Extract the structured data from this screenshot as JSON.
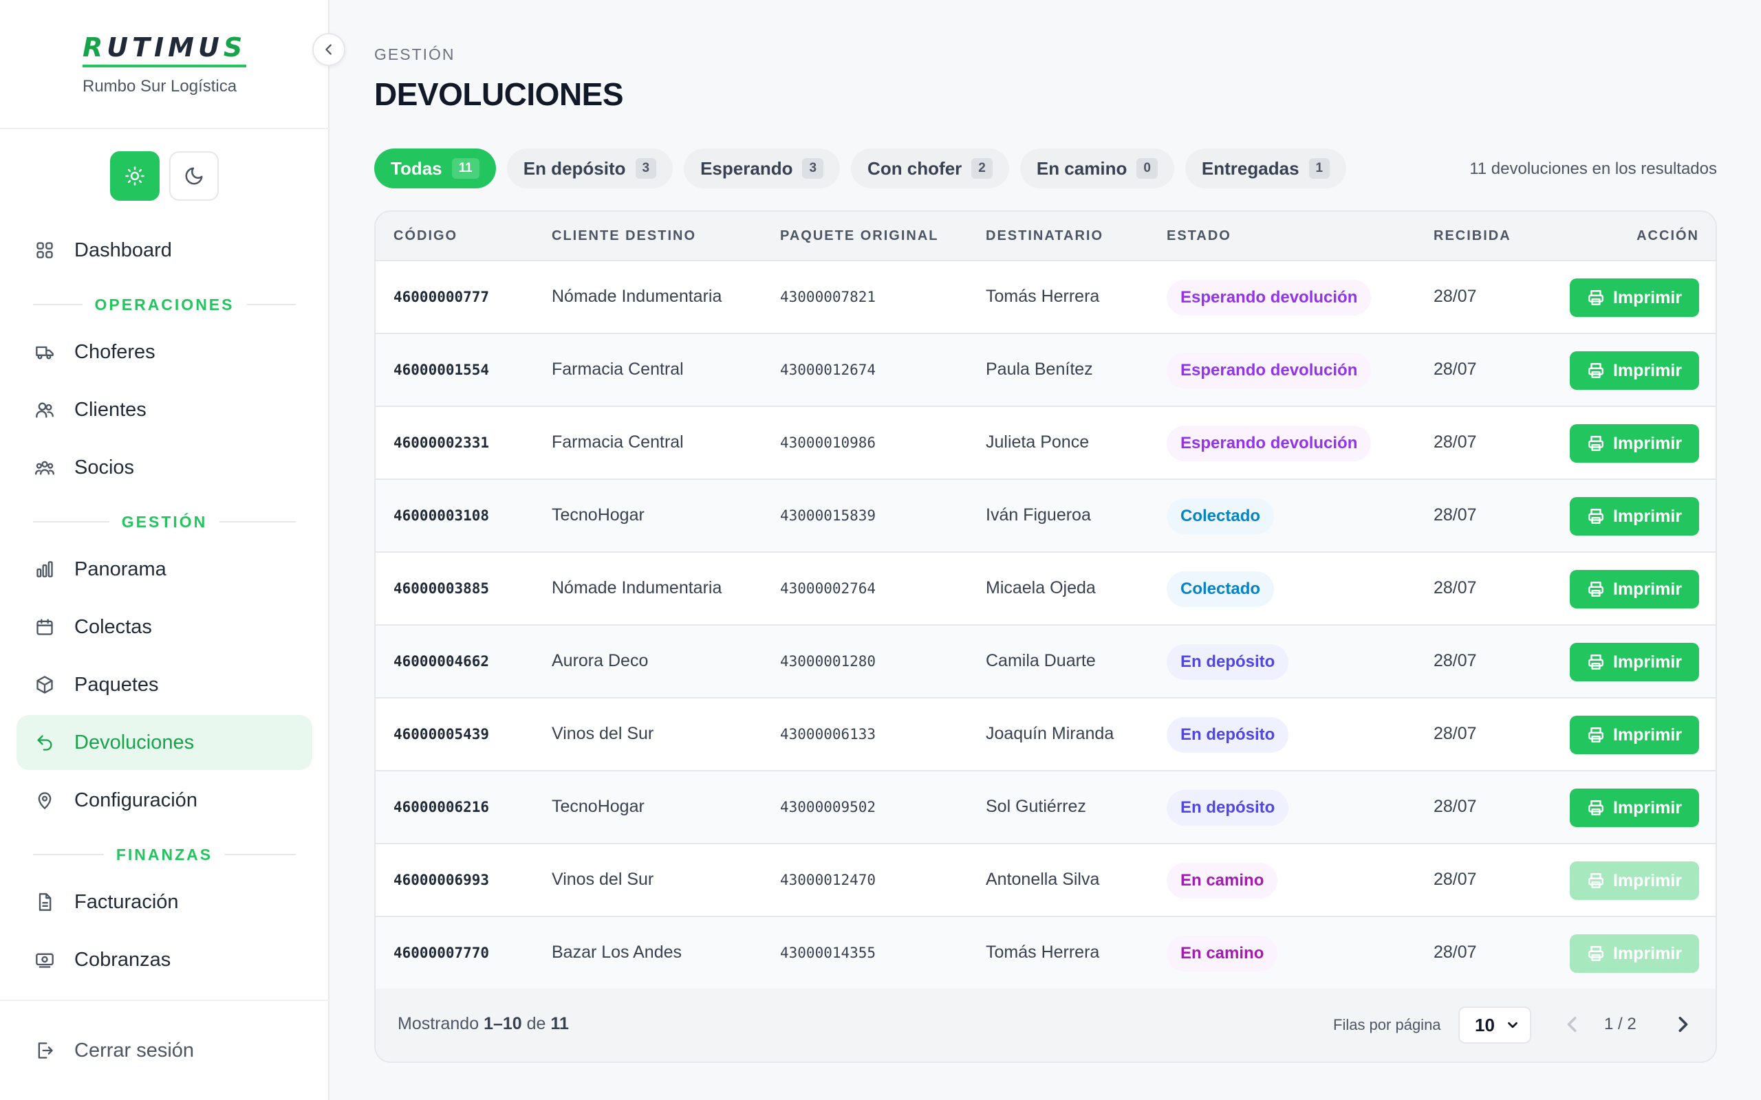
{
  "brand": {
    "logo_r": "R",
    "logo_mid": "UTIMU",
    "logo_s": "S",
    "subtitle": "Rumbo Sur Logística"
  },
  "theme": {
    "light_icon": "sun-icon",
    "dark_icon": "moon-icon",
    "active": "light"
  },
  "sidebar": {
    "dashboard": "Dashboard",
    "section_operaciones": "OPERACIONES",
    "choferes": "Choferes",
    "clientes": "Clientes",
    "socios": "Socios",
    "section_gestion": "GESTIÓN",
    "panorama": "Panorama",
    "colectas": "Colectas",
    "paquetes": "Paquetes",
    "devoluciones": "Devoluciones",
    "configuracion": "Configuración",
    "section_finanzas": "FINANZAS",
    "facturacion": "Facturación",
    "cobranzas": "Cobranzas",
    "logout": "Cerrar sesión"
  },
  "header": {
    "breadcrumb": "GESTIÓN",
    "title": "DEVOLUCIONES"
  },
  "filters": [
    {
      "label": "Todas",
      "count": "11",
      "active": true
    },
    {
      "label": "En depósito",
      "count": "3"
    },
    {
      "label": "Esperando",
      "count": "3"
    },
    {
      "label": "Con chofer",
      "count": "2"
    },
    {
      "label": "En camino",
      "count": "0"
    },
    {
      "label": "Entregadas",
      "count": "1"
    }
  ],
  "results_text": "11 devoluciones en los resultados",
  "table": {
    "headers": {
      "code": "CÓDIGO",
      "client": "CLIENTE DESTINO",
      "package": "PAQUETE ORIGINAL",
      "recipient": "DESTINATARIO",
      "status": "ESTADO",
      "received": "RECIBIDA",
      "action": "ACCIÓN"
    },
    "action_label": "Imprimir",
    "rows": [
      {
        "code": "46000000777",
        "client": "Nómade Indumentaria",
        "package": "43000007821",
        "recipient": "Tomás Herrera",
        "status": "Esperando devolución",
        "received": "28/07"
      },
      {
        "code": "46000001554",
        "client": "Farmacia Central",
        "package": "43000012674",
        "recipient": "Paula Benítez",
        "status": "Esperando devolución",
        "received": "28/07"
      },
      {
        "code": "46000002331",
        "client": "Farmacia Central",
        "package": "43000010986",
        "recipient": "Julieta Ponce",
        "status": "Esperando devolución",
        "received": "28/07"
      },
      {
        "code": "46000003108",
        "client": "TecnoHogar",
        "package": "43000015839",
        "recipient": "Iván Figueroa",
        "status": "Colectado",
        "received": "28/07"
      },
      {
        "code": "46000003885",
        "client": "Nómade Indumentaria",
        "package": "43000002764",
        "recipient": "Micaela Ojeda",
        "status": "Colectado",
        "received": "28/07"
      },
      {
        "code": "46000004662",
        "client": "Aurora Deco",
        "package": "43000001280",
        "recipient": "Camila Duarte",
        "status": "En depósito",
        "received": "28/07"
      },
      {
        "code": "46000005439",
        "client": "Vinos del Sur",
        "package": "43000006133",
        "recipient": "Joaquín Miranda",
        "status": "En depósito",
        "received": "28/07"
      },
      {
        "code": "46000006216",
        "client": "TecnoHogar",
        "package": "43000009502",
        "recipient": "Sol Gutiérrez",
        "status": "En depósito",
        "received": "28/07"
      },
      {
        "code": "46000006993",
        "client": "Vinos del Sur",
        "package": "43000012470",
        "recipient": "Antonella Silva",
        "status": "En camino",
        "received": "28/07"
      },
      {
        "code": "46000007770",
        "client": "Bazar Los Andes",
        "package": "43000014355",
        "recipient": "Tomás Herrera",
        "status": "En camino",
        "received": "28/07"
      }
    ]
  },
  "footer": {
    "showing_prefix": "Mostrando",
    "showing_range": "1–10",
    "showing_of": "de",
    "showing_total": "11",
    "rows_per_page_label": "Filas por página",
    "rows_per_page_value": "10",
    "page_indicator": "1 / 2"
  },
  "colors": {
    "accent": "#22c55e",
    "accent_dark": "#16a34a",
    "status_waiting": "#9333ea",
    "status_collected": "#0284c7",
    "status_deposit": "#4f46e5",
    "status_onway": "#a21caf"
  }
}
